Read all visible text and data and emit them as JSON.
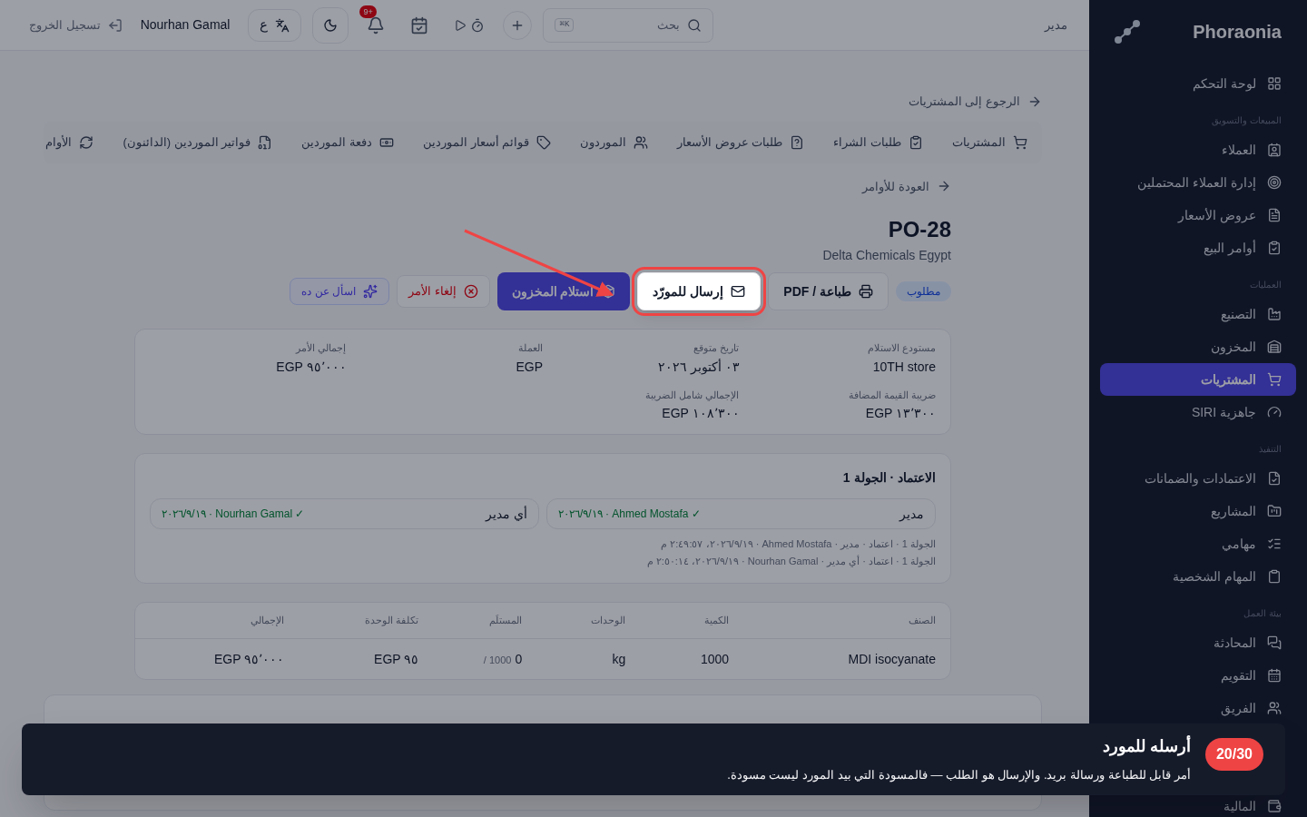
{
  "sidebar": {
    "logo": "Phoraonia",
    "sections": [
      {
        "items": [
          {
            "label": "لوحة التحكم",
            "selected": false
          }
        ]
      },
      {
        "title": "المبيعات والتسويق",
        "items": [
          {
            "label": "العملاء",
            "selected": false
          },
          {
            "label": "إدارة العملاء المحتملين",
            "selected": false
          },
          {
            "label": "عروض الأسعار",
            "selected": false
          },
          {
            "label": "أوامر البيع",
            "selected": false
          }
        ]
      },
      {
        "title": "العمليات",
        "items": [
          {
            "label": "التصنيع",
            "selected": false
          },
          {
            "label": "المخزون",
            "selected": false
          },
          {
            "label": "المشتريات",
            "selected": true
          },
          {
            "label": "جاهزية SIRI",
            "selected": false
          }
        ]
      },
      {
        "title": "التنفيذ",
        "items": [
          {
            "label": "الاعتمادات والضمانات",
            "selected": false
          },
          {
            "label": "المشاريع",
            "selected": false
          },
          {
            "label": "مهامي",
            "selected": false
          },
          {
            "label": "المهام الشخصية",
            "selected": false
          }
        ]
      },
      {
        "title": "بيئة العمل",
        "items": [
          {
            "label": "المحادثة",
            "selected": false
          },
          {
            "label": "التقويم",
            "selected": false
          },
          {
            "label": "الفريق",
            "selected": false
          }
        ]
      },
      {
        "items": [
          {
            "label": "المالية",
            "selected": false
          }
        ]
      }
    ]
  },
  "topbar": {
    "role": "مدير",
    "search": {
      "placeholder": "بحث",
      "shortcut": "K⌘"
    },
    "notifications": "+9",
    "language": "ع",
    "user": "Nourhan Gamal",
    "logout": "تسجيل الخروج"
  },
  "back_link": "الرجوع إلى المشتريات",
  "tabs": [
    {
      "label": "المشتريات",
      "selected": false
    },
    {
      "label": "طلبات الشراء",
      "selected": false
    },
    {
      "label": "طلبات عروض الأسعار",
      "selected": false
    },
    {
      "label": "الموردون",
      "selected": false
    },
    {
      "label": "قوائم أسعار الموردين",
      "selected": false
    },
    {
      "label": "دفعة الموردين",
      "selected": false
    },
    {
      "label": "فواتير الموردين (الدائنون)",
      "selected": false
    },
    {
      "label": "الأوام",
      "selected": false
    }
  ],
  "orders_link": "العودة للأوامر",
  "order": {
    "number": "PO-28",
    "supplier": "Delta Chemicals Egypt",
    "status": "مطلوب"
  },
  "actions": [
    {
      "label": "طباعة / PDF",
      "kind": "outline",
      "highlighted": false
    },
    {
      "label": "إرسال للمورّد",
      "kind": "outline",
      "highlighted": true
    },
    {
      "label": "استلام المخزون",
      "kind": "primary",
      "highlighted": false
    },
    {
      "label": "إلغاء الأمر",
      "kind": "danger",
      "highlighted": false
    },
    {
      "label": "اسأل عن ده",
      "kind": "ai",
      "highlighted": false
    }
  ],
  "details": [
    {
      "label": "مستودع الاستلام",
      "value": "10TH store"
    },
    {
      "label": "تاريخ متوقع",
      "value": "٠٣ أكتوبر ٢٠٢٦"
    },
    {
      "label": "العملة",
      "value": "EGP"
    },
    {
      "label": "إجمالي الأمر",
      "value": "EGP ٩٥٬٠٠٠"
    },
    {
      "label": "ضريبة القيمة المضافة",
      "value": "EGP ١٣٬٣٠٠"
    },
    {
      "label": "الإجمالي شامل الضريبة",
      "value": "EGP ١٠٨٬٣٠٠"
    }
  ],
  "approval": {
    "title": "الاعتماد · الجولة 1",
    "steps": [
      {
        "role": "مدير",
        "result": "✓ Ahmed Mostafa · ٢٠٢٦/٩/١٩"
      },
      {
        "role": "أي مدير",
        "result": "✓ Nourhan Gamal · ٢٠٢٦/٩/١٩"
      }
    ],
    "log": [
      "الجولة 1 · اعتماد · مدير · Ahmed Mostafa · ٢٠٢٦/٩/١٩، ٢:٤٩:٥٧ م",
      "الجولة 1 · اعتماد · أي مدير · Nourhan Gamal · ٢٠٢٦/٩/١٩، ٢:٥٠:١٤ م"
    ]
  },
  "table": {
    "columns": [
      "الصنف",
      "الكمية",
      "الوحدات",
      "المستلَم",
      "تكلفة الوحدة",
      "الإجمالي"
    ],
    "rows": [
      {
        "item": "MDI isocyanate",
        "quantity": "1000",
        "unit": "kg",
        "received": "0",
        "ordered": "/ 1000",
        "unit_cost": "EGP ٩٥",
        "total": "EGP ٩٥٬٠٠٠"
      }
    ]
  },
  "tour": {
    "step": "20/30",
    "title": "أرسله للمورد",
    "text": "أمر قابل للطباعة ورسالة بريد. والإرسال هو الطلب — فالمسودة التي بيد المورد ليست مسودة."
  }
}
